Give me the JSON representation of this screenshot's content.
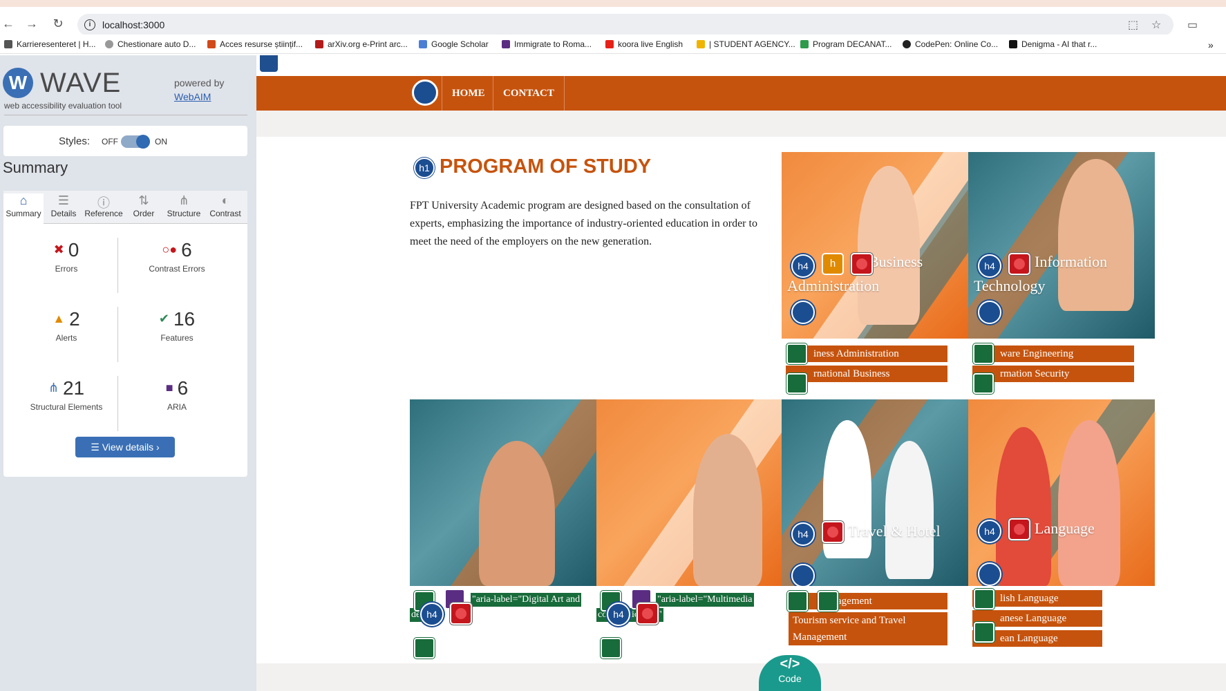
{
  "browser": {
    "url": "localhost:3000",
    "bookmarks": [
      "Karrieresenteret | H...",
      "Chestionare auto D...",
      "Acces resurse științif...",
      "arXiv.org e-Print arc...",
      "Google Scholar",
      "Immigrate to Roma...",
      "koora live English",
      "| STUDENT AGENCY...",
      "Program DECANAT...",
      "CodePen: Online Co...",
      "Denigma - AI that r..."
    ]
  },
  "wave": {
    "logo_text": "WAVE",
    "logo_sub": "web accessibility evaluation tool",
    "powered_by": "powered by",
    "webaim": "WebAIM",
    "styles_label": "Styles:",
    "styles_off": "OFF",
    "styles_on": "ON",
    "summary_heading": "Summary",
    "tabs": [
      "Summary",
      "Details",
      "Reference",
      "Order",
      "Structure",
      "Contrast"
    ],
    "stats": {
      "errors": {
        "value": "0",
        "label": "Errors"
      },
      "contrast": {
        "value": "6",
        "label": "Contrast Errors"
      },
      "alerts": {
        "value": "2",
        "label": "Alerts"
      },
      "features": {
        "value": "16",
        "label": "Features"
      },
      "structural": {
        "value": "21",
        "label": "Structural Elements"
      },
      "aria": {
        "value": "6",
        "label": "ARIA"
      }
    },
    "view_details": "View details ›"
  },
  "site": {
    "nav": [
      "HOME",
      "CONTACT"
    ],
    "h1_badge": "h1",
    "title": "PROGRAM OF STUDY",
    "description": "FPT University Academic program are designed based on the consultation of experts, emphasizing the importance of industry-oriented education in order to meet the need of the employers on the new generation.",
    "h4_badge": "h4",
    "cards": {
      "business": {
        "title1": "Business",
        "title2": "Administration",
        "subs": [
          "iness Administration",
          "rnational Business"
        ]
      },
      "it": {
        "title1": "Information",
        "title2": "Technology",
        "subs": [
          "ware Engineering",
          "rmation Security"
        ]
      },
      "digital": {
        "aria_text": "\"aria-label=\"Digital Art and",
        "aria_text2": "design\""
      },
      "multimedia": {
        "aria_text": "\"aria-label=\"Multimedia",
        "aria_text2": "communication\""
      },
      "travel": {
        "title": "Travel & Hotel",
        "subs": [
          "agement",
          "Tourism service and Travel Management"
        ]
      },
      "language": {
        "title": "Language",
        "subs": [
          "lish Language",
          "anese Language",
          "ean Language"
        ]
      }
    },
    "code_tab": "Code",
    "code_glyph": "</>"
  }
}
